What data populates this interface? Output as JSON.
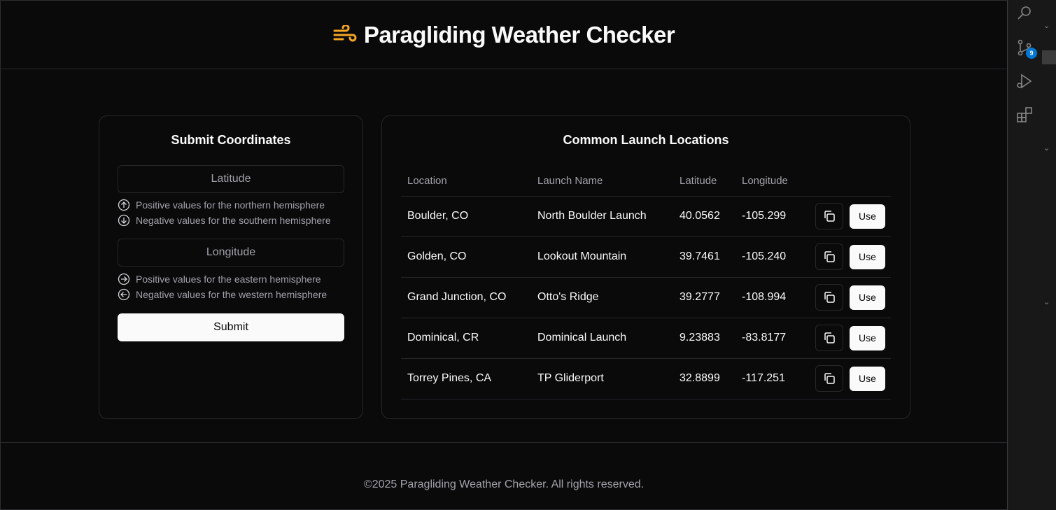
{
  "header": {
    "title": "Paragliding Weather Checker",
    "logo_icon": "wind-icon",
    "accent_color": "#f5a524"
  },
  "form": {
    "title": "Submit Coordinates",
    "latitude_placeholder": "Latitude",
    "longitude_placeholder": "Longitude",
    "lat_hints": [
      {
        "icon": "arrow-up-circle-icon",
        "text": "Positive values for the northern hemisphere"
      },
      {
        "icon": "arrow-down-circle-icon",
        "text": "Negative values for the southern hemisphere"
      }
    ],
    "lon_hints": [
      {
        "icon": "arrow-right-circle-icon",
        "text": "Positive values for the eastern hemisphere"
      },
      {
        "icon": "arrow-left-circle-icon",
        "text": "Negative values for the western hemisphere"
      }
    ],
    "submit_label": "Submit"
  },
  "locations": {
    "title": "Common Launch Locations",
    "columns": [
      "Location",
      "Launch Name",
      "Latitude",
      "Longitude"
    ],
    "use_label": "Use",
    "rows": [
      {
        "location": "Boulder, CO",
        "launch": "North Boulder Launch",
        "lat": "40.0562",
        "lon": "-105.299"
      },
      {
        "location": "Golden, CO",
        "launch": "Lookout Mountain",
        "lat": "39.7461",
        "lon": "-105.240"
      },
      {
        "location": "Grand Junction, CO",
        "launch": "Otto's Ridge",
        "lat": "39.2777",
        "lon": "-108.994"
      },
      {
        "location": "Dominical, CR",
        "launch": "Dominical Launch",
        "lat": "9.23883",
        "lon": "-83.8177"
      },
      {
        "location": "Torrey Pines, CA",
        "launch": "TP Gliderport",
        "lat": "32.8899",
        "lon": "-117.251"
      }
    ]
  },
  "footer": {
    "text": "©2025 Paragliding Weather Checker. All rights reserved."
  },
  "activity_bar": {
    "source_control_badge": "9"
  }
}
